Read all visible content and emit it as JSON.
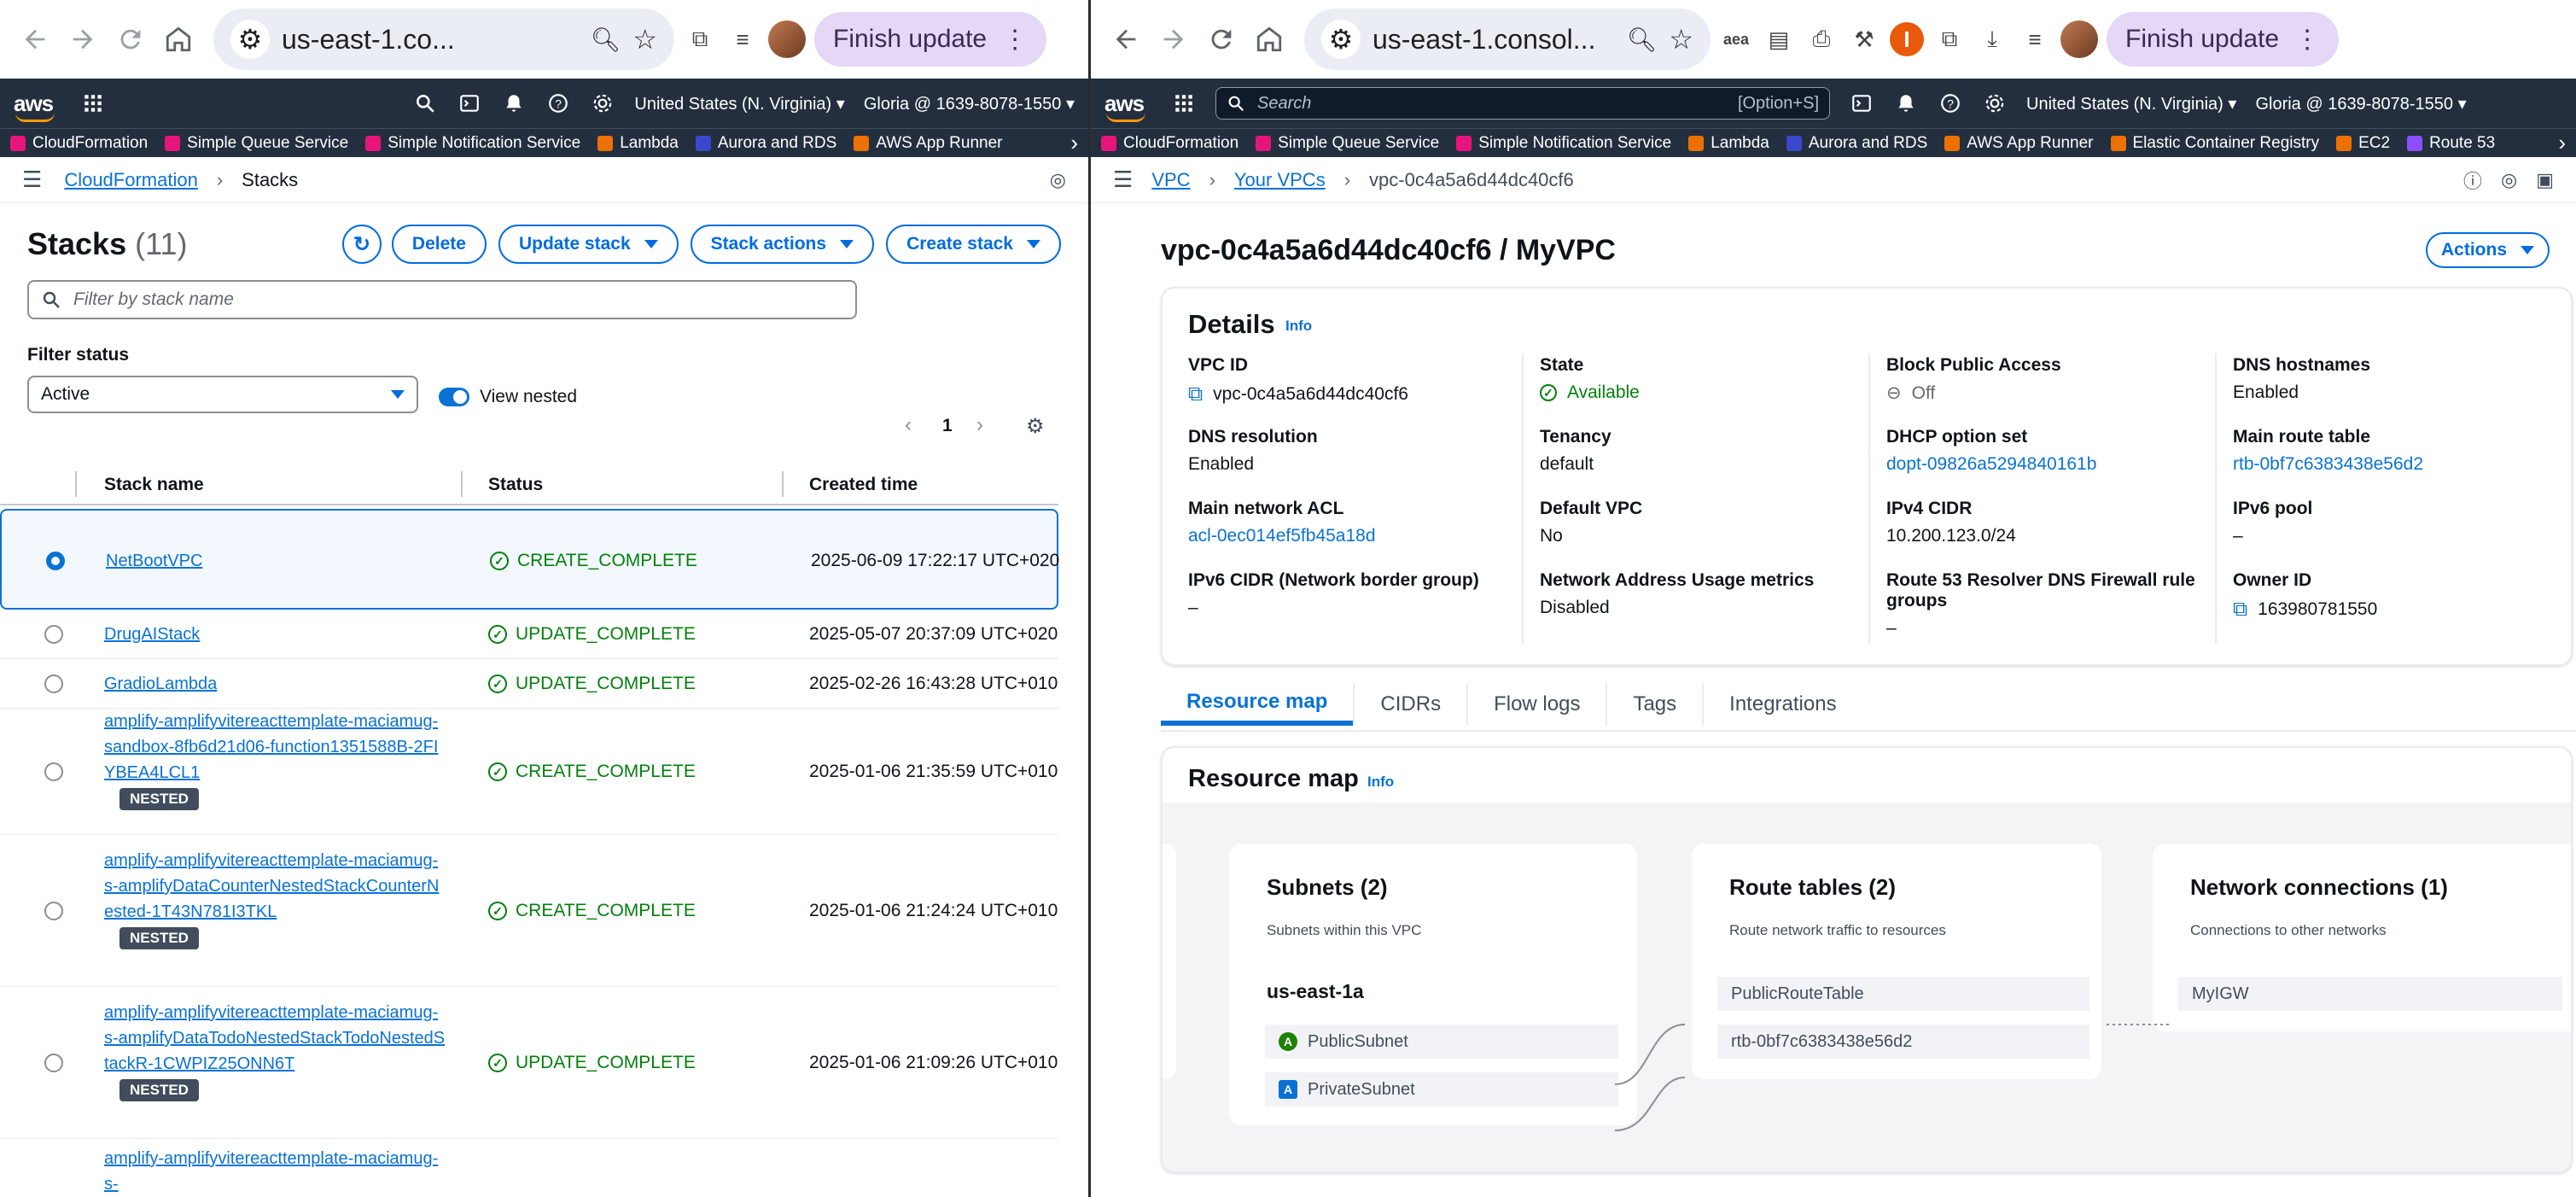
{
  "left_browser": {
    "url": "us-east-1.co...",
    "finish_update": "Finish update",
    "region": "United States (N. Virginia)",
    "account": "Gloria @ 1639-8078-1550"
  },
  "right_browser": {
    "url": "us-east-1.consol...",
    "finish_update": "Finish update",
    "region": "United States (N. Virginia)",
    "account": "Gloria @ 1639-8078-1550",
    "search_placeholder": "Search",
    "search_shortcut": "[Option+S]"
  },
  "favorites_left": [
    "CloudFormation",
    "Simple Queue Service",
    "Simple Notification Service",
    "Lambda",
    "Aurora and RDS",
    "AWS App Runner"
  ],
  "favorites_right": [
    "CloudFormation",
    "Simple Queue Service",
    "Simple Notification Service",
    "Lambda",
    "Aurora and RDS",
    "AWS App Runner",
    "Elastic Container Registry",
    "EC2",
    "Route 53"
  ],
  "favorite_colors": [
    "#e7157b",
    "#e7157b",
    "#e7157b",
    "#ed7100",
    "#3b48cc",
    "#ed7100",
    "#ed7100",
    "#ed7100",
    "#8c4fff"
  ],
  "cf": {
    "breadcrumb": [
      "CloudFormation",
      "Stacks"
    ],
    "title": "Stacks",
    "count": "(11)",
    "buttons": {
      "delete": "Delete",
      "update": "Update stack",
      "actions": "Stack actions",
      "create": "Create stack"
    },
    "filter_placeholder": "Filter by stack name",
    "filter_status_label": "Filter status",
    "filter_status_value": "Active",
    "view_nested": "View nested",
    "page": "1",
    "columns": [
      "Stack name",
      "Status",
      "Created time"
    ],
    "rows": [
      {
        "name": "NetBootVPC",
        "nested": false,
        "status": "CREATE_COMPLETE",
        "created": "2025-06-09 17:22:17 UTC+020",
        "selected": true
      },
      {
        "name": "DrugAIStack",
        "nested": false,
        "status": "UPDATE_COMPLETE",
        "created": "2025-05-07 20:37:09 UTC+020",
        "selected": false
      },
      {
        "name": "GradioLambda",
        "nested": false,
        "status": "UPDATE_COMPLETE",
        "created": "2025-02-26 16:43:28 UTC+010",
        "selected": false
      },
      {
        "name": "amplify-amplifyvitereacttemplate-maciamug-sandbox-8fb6d21d06-function1351588B-2FIYBEA4LCL1",
        "nested": true,
        "status": "CREATE_COMPLETE",
        "created": "2025-01-06 21:35:59 UTC+010",
        "selected": false
      },
      {
        "name": "amplify-amplifyvitereacttemplate-maciamug-s-amplifyDataCounterNestedStackCounterNested-1T43N781I3TKL",
        "nested": true,
        "status": "CREATE_COMPLETE",
        "created": "2025-01-06 21:24:24 UTC+010",
        "selected": false
      },
      {
        "name": "amplify-amplifyvitereacttemplate-maciamug-s-amplifyDataTodoNestedStackTodoNestedStackR-1CWPIZ25ONN6T",
        "nested": true,
        "status": "UPDATE_COMPLETE",
        "created": "2025-01-06 21:09:26 UTC+010",
        "selected": false
      },
      {
        "name": "amplify-amplifyvitereacttemplate-maciamug-s-",
        "nested": false,
        "status": "",
        "created": "",
        "selected": false
      }
    ],
    "nested_badge": "NESTED"
  },
  "vpc": {
    "breadcrumb": [
      "VPC",
      "Your VPCs",
      "vpc-0c4a5a6d44dc40cf6"
    ],
    "title": "vpc-0c4a5a6d44dc40cf6 / MyVPC",
    "actions": "Actions",
    "details_title": "Details",
    "info": "Info",
    "details": {
      "vpc_id": {
        "label": "VPC ID",
        "value": "vpc-0c4a5a6d44dc40cf6"
      },
      "state": {
        "label": "State",
        "value": "Available"
      },
      "bpa": {
        "label": "Block Public Access",
        "value": "Off"
      },
      "dns_hostnames": {
        "label": "DNS hostnames",
        "value": "Enabled"
      },
      "dns_resolution": {
        "label": "DNS resolution",
        "value": "Enabled"
      },
      "tenancy": {
        "label": "Tenancy",
        "value": "default"
      },
      "dhcp": {
        "label": "DHCP option set",
        "value": "dopt-09826a5294840161b"
      },
      "main_rt": {
        "label": "Main route table",
        "value": "rtb-0bf7c6383438e56d2"
      },
      "main_acl": {
        "label": "Main network ACL",
        "value": "acl-0ec014ef5fb45a18d"
      },
      "default_vpc": {
        "label": "Default VPC",
        "value": "No"
      },
      "ipv4": {
        "label": "IPv4 CIDR",
        "value": "10.200.123.0/24"
      },
      "ipv6_pool": {
        "label": "IPv6 pool",
        "value": "–"
      },
      "ipv6_cidr": {
        "label": "IPv6 CIDR (Network border group)",
        "value": "–"
      },
      "nau": {
        "label": "Network Address Usage metrics",
        "value": "Disabled"
      },
      "r53": {
        "label": "Route 53 Resolver DNS Firewall rule groups",
        "value": "–"
      },
      "owner": {
        "label": "Owner ID",
        "value": "163980781550"
      }
    },
    "tabs": [
      "Resource map",
      "CIDRs",
      "Flow logs",
      "Tags",
      "Integrations"
    ],
    "resource_map": {
      "title": "Resource map",
      "subnets": {
        "title": "Subnets (2)",
        "sub": "Subnets within this VPC",
        "az": "us-east-1a",
        "items": [
          {
            "badge": "A",
            "name": "PublicSubnet",
            "color": "#1d8102"
          },
          {
            "badge": "A",
            "name": "PrivateSubnet",
            "color": "#0972d3"
          }
        ]
      },
      "route_tables": {
        "title": "Route tables (2)",
        "sub": "Route network traffic to resources",
        "items": [
          "PublicRouteTable",
          "rtb-0bf7c6383438e56d2"
        ]
      },
      "network": {
        "title": "Network connections (1)",
        "sub": "Connections to other networks",
        "items": [
          "MyIGW"
        ]
      }
    }
  }
}
